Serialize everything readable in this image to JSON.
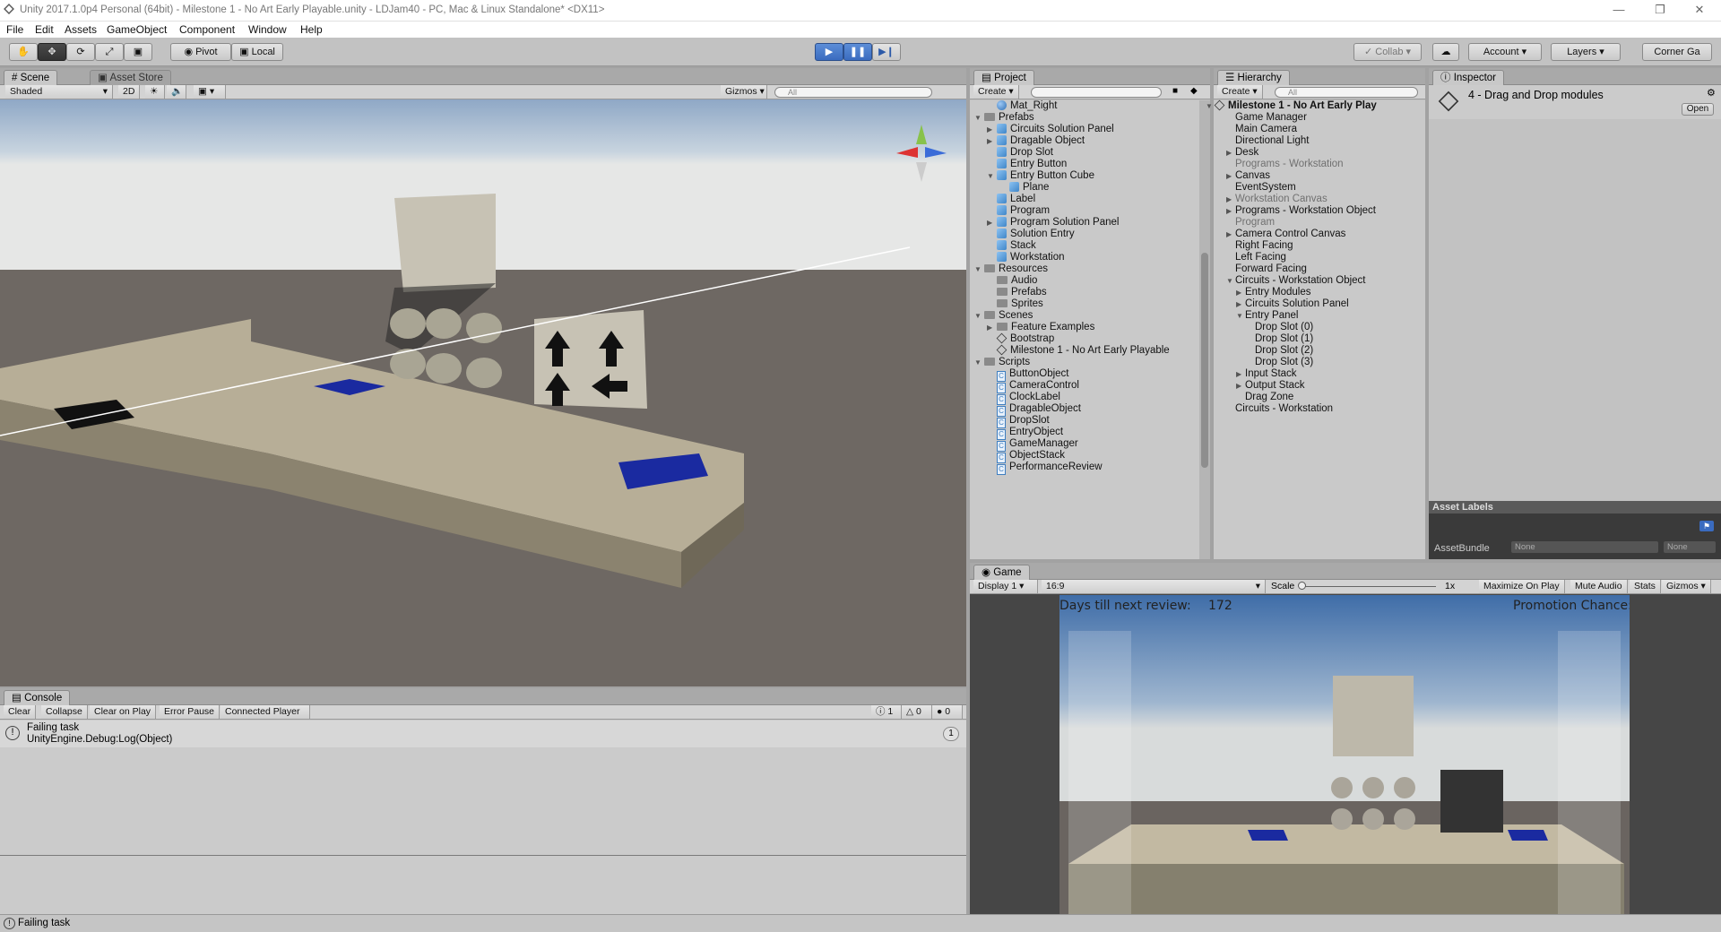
{
  "window": {
    "title": "Unity 2017.1.0p4 Personal (64bit) - Milestone 1 - No Art Early Playable.unity - LDJam40 - PC, Mac & Linux Standalone* <DX11>"
  },
  "menu": [
    "File",
    "Edit",
    "Assets",
    "GameObject",
    "Component",
    "Window",
    "Help"
  ],
  "toolbar": {
    "pivot_label": "Pivot",
    "local_label": "Local",
    "collab_label": "Collab",
    "account_label": "Account",
    "layers_label": "Layers",
    "layout_label": "Corner Ga"
  },
  "scene": {
    "tab": "Scene",
    "tab2": "Asset Store",
    "shading": "Shaded",
    "mode_2d": "2D",
    "gizmos": "Gizmos",
    "search_placeholder": "All"
  },
  "project": {
    "tab": "Project",
    "create": "Create",
    "items": [
      {
        "label": "Mat_Right",
        "icon": "material"
      },
      {
        "label": "Prefabs",
        "icon": "folder"
      },
      {
        "label": "Circuits Solution Panel",
        "icon": "prefab"
      },
      {
        "label": "Dragable Object",
        "icon": "prefab"
      },
      {
        "label": "Drop Slot",
        "icon": "prefab"
      },
      {
        "label": "Entry Button",
        "icon": "prefab"
      },
      {
        "label": "Entry Button Cube",
        "icon": "prefab"
      },
      {
        "label": "Plane",
        "icon": "prefab"
      },
      {
        "label": "Label",
        "icon": "prefab"
      },
      {
        "label": "Program",
        "icon": "prefab"
      },
      {
        "label": "Program Solution Panel",
        "icon": "prefab"
      },
      {
        "label": "Solution Entry",
        "icon": "prefab"
      },
      {
        "label": "Stack",
        "icon": "prefab"
      },
      {
        "label": "Workstation",
        "icon": "prefab"
      },
      {
        "label": "Resources",
        "icon": "folder"
      },
      {
        "label": "Audio",
        "icon": "folder"
      },
      {
        "label": "Prefabs",
        "icon": "folder"
      },
      {
        "label": "Sprites",
        "icon": "folder"
      },
      {
        "label": "Scenes",
        "icon": "folder"
      },
      {
        "label": "Feature Examples",
        "icon": "folder"
      },
      {
        "label": "Bootstrap",
        "icon": "scene"
      },
      {
        "label": "Milestone 1 - No Art Early Playable",
        "icon": "scene"
      },
      {
        "label": "Scripts",
        "icon": "folder"
      },
      {
        "label": "ButtonObject",
        "icon": "script"
      },
      {
        "label": "CameraControl",
        "icon": "script"
      },
      {
        "label": "ClockLabel",
        "icon": "script"
      },
      {
        "label": "DragableObject",
        "icon": "script"
      },
      {
        "label": "DropSlot",
        "icon": "script"
      },
      {
        "label": "EntryObject",
        "icon": "script"
      },
      {
        "label": "GameManager",
        "icon": "script"
      },
      {
        "label": "ObjectStack",
        "icon": "script"
      },
      {
        "label": "PerformanceReview",
        "icon": "script"
      }
    ]
  },
  "hierarchy": {
    "tab": "Hierarchy",
    "create": "Create",
    "search_placeholder": "All",
    "items": [
      {
        "label": "Milestone 1 - No Art Early Play",
        "style": "bold"
      },
      {
        "label": "Game Manager",
        "style": "normal"
      },
      {
        "label": "Main Camera",
        "style": "normal"
      },
      {
        "label": "Directional Light",
        "style": "normal"
      },
      {
        "label": "Desk",
        "style": "normal"
      },
      {
        "label": "Programs - Workstation",
        "style": "dim"
      },
      {
        "label": "Canvas",
        "style": "normal"
      },
      {
        "label": "EventSystem",
        "style": "normal"
      },
      {
        "label": "Workstation Canvas",
        "style": "dim"
      },
      {
        "label": "Programs - Workstation Object",
        "style": "normal"
      },
      {
        "label": "Program",
        "style": "dim"
      },
      {
        "label": "Camera Control Canvas",
        "style": "normal"
      },
      {
        "label": "Right Facing",
        "style": "normal"
      },
      {
        "label": "Left Facing",
        "style": "normal"
      },
      {
        "label": "Forward Facing",
        "style": "normal"
      },
      {
        "label": "Circuits - Workstation Object",
        "style": "normal"
      },
      {
        "label": "Entry Modules",
        "style": "normal"
      },
      {
        "label": "Circuits Solution Panel",
        "style": "normal"
      },
      {
        "label": "Entry Panel",
        "style": "normal"
      },
      {
        "label": "Drop Slot (0)",
        "style": "normal"
      },
      {
        "label": "Drop Slot (1)",
        "style": "normal"
      },
      {
        "label": "Drop Slot (2)",
        "style": "normal"
      },
      {
        "label": "Drop Slot (3)",
        "style": "normal"
      },
      {
        "label": "Input Stack",
        "style": "normal"
      },
      {
        "label": "Output Stack",
        "style": "normal"
      },
      {
        "label": "Drag Zone",
        "style": "normal"
      },
      {
        "label": "Circuits - Workstation",
        "style": "normal"
      }
    ]
  },
  "inspector": {
    "tab": "Inspector",
    "asset_name": "4 - Drag and Drop modules",
    "open_button": "Open",
    "asset_labels": "Asset Labels",
    "asset_bundle": "AssetBundle",
    "bundle_value": "None",
    "variant_value": "None"
  },
  "game": {
    "tab": "Game",
    "display": "Display 1",
    "aspect": "16:9",
    "scale_label": "Scale",
    "scale_value": "1x",
    "maximize": "Maximize On Play",
    "mute": "Mute Audio",
    "stats": "Stats",
    "gizmos": "Gizmos",
    "days_label": "Days till next review:",
    "days_value": "172",
    "promotion_label": "Promotion Chance:"
  },
  "console": {
    "tab": "Console",
    "clear": "Clear",
    "collapse": "Collapse",
    "clear_on_play": "Clear on Play",
    "error_pause": "Error Pause",
    "connected": "Connected Player",
    "count_info": "1",
    "count_warn": "0",
    "count_err": "0",
    "entry_line1": "Failing task",
    "entry_line2": "UnityEngine.Debug:Log(Object)",
    "entry_count": "1"
  },
  "status": {
    "message": "Failing task"
  },
  "colors": {
    "play_blue": "#3a6bbf",
    "panel_gray": "#c2c2c2",
    "game_dark": "#464646"
  }
}
